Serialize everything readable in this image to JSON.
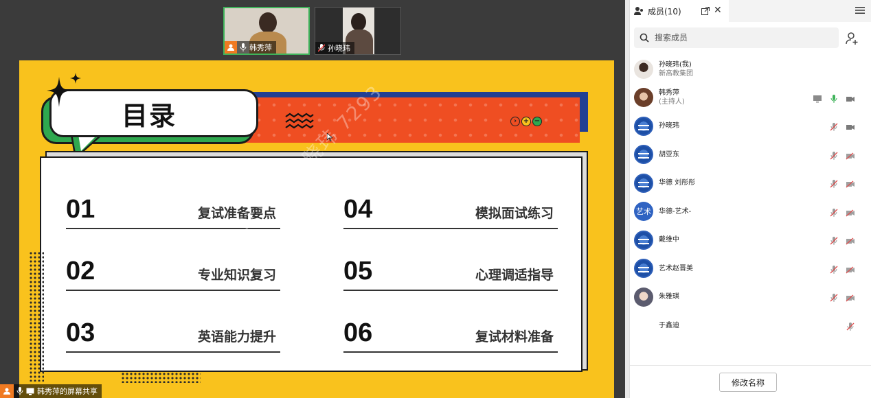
{
  "video_tiles": [
    {
      "name": "韩秀萍",
      "is_host": true
    },
    {
      "name": "孙晓玮",
      "is_host": false
    }
  ],
  "slide": {
    "title": "目录",
    "watermark": "9FVPg 孙晓玮 7293",
    "toc": [
      {
        "num": "01",
        "label": "复试准备要点"
      },
      {
        "num": "02",
        "label": "专业知识复习"
      },
      {
        "num": "03",
        "label": "英语能力提升"
      },
      {
        "num": "04",
        "label": "模拟面试练习"
      },
      {
        "num": "05",
        "label": "心理调适指导"
      },
      {
        "num": "06",
        "label": "复试材料准备"
      }
    ],
    "mini_controls": [
      "›",
      "+",
      "−"
    ]
  },
  "share_bar": {
    "text": "韩秀萍的屏幕共享"
  },
  "panel": {
    "title": "成员(10)",
    "search_placeholder": "搜索成员",
    "rename_label": "修改名称",
    "members": [
      {
        "name": "孙晓玮(我)",
        "sub": "新高教集团",
        "avatar": "photo1",
        "icons": []
      },
      {
        "name": "韩秀萍",
        "sub": "(主持人)",
        "avatar": "photo2",
        "icons": [
          "screen-share-icon",
          "mic-active-icon",
          "camera-icon"
        ]
      },
      {
        "name": "孙晓玮",
        "sub": "",
        "avatar": "org",
        "icons": [
          "mic-muted-icon",
          "camera-icon"
        ]
      },
      {
        "name": "胡亚东",
        "sub": "",
        "avatar": "org",
        "icons": [
          "mic-muted-icon",
          "camera-off-icon"
        ]
      },
      {
        "name": "华德 刘彤彤",
        "sub": "",
        "avatar": "org",
        "icons": [
          "mic-muted-icon",
          "camera-off-icon"
        ]
      },
      {
        "name": "华德-艺术-",
        "sub": "",
        "avatar": "art",
        "avatar_text": "艺术",
        "icons": [
          "mic-muted-icon",
          "camera-off-icon"
        ]
      },
      {
        "name": "戴维中",
        "sub": "",
        "avatar": "org",
        "icons": [
          "mic-muted-icon",
          "camera-off-icon"
        ]
      },
      {
        "name": "艺术赵晋美",
        "sub": "",
        "avatar": "org",
        "icons": [
          "mic-muted-icon",
          "camera-off-icon"
        ]
      },
      {
        "name": "朱雅琪",
        "sub": "",
        "avatar": "photo3",
        "icons": [
          "mic-muted-icon",
          "camera-off-icon"
        ]
      },
      {
        "name": "于鑫迪",
        "sub": "",
        "avatar": "photo4",
        "icons": [
          "mic-muted-icon"
        ]
      }
    ]
  },
  "colors": {
    "slide_bg": "#f9c21d",
    "banner_red": "#ef4e22",
    "banner_blue": "#223f93",
    "accent_green": "#2fa84f",
    "host_orange": "#f07a22"
  }
}
